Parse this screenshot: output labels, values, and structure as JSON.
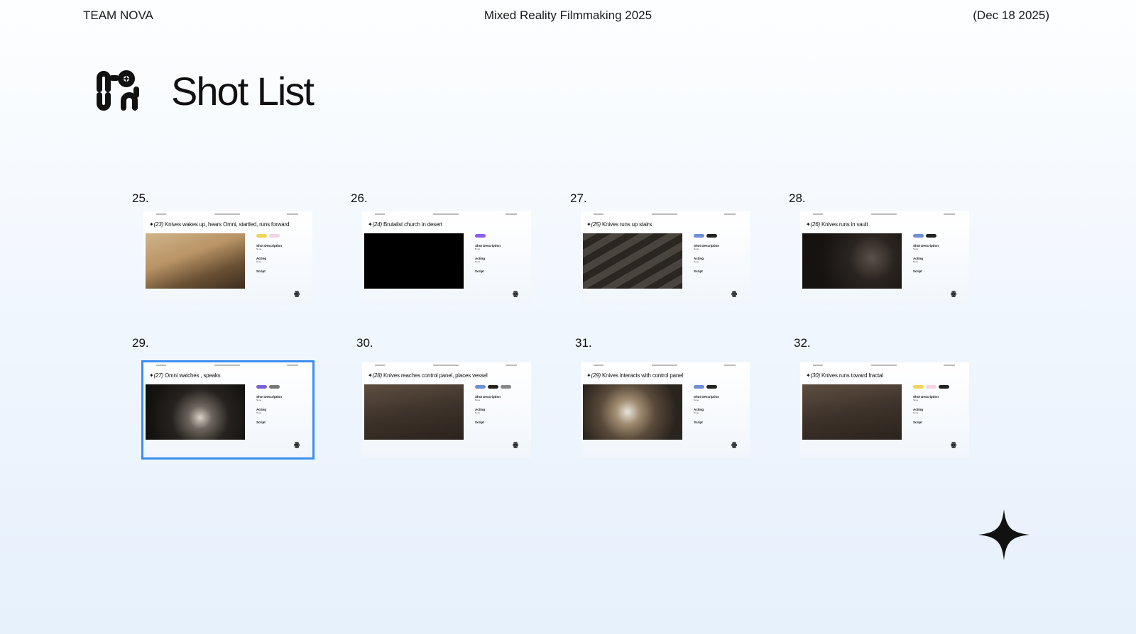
{
  "header": {
    "team": "TEAM NOVA",
    "project": "Mixed Reality Filmmaking 2025",
    "date": "(Dec 18 2025)"
  },
  "page_title": "Shot List",
  "colors": {
    "selection": "#3b8ff0",
    "accent": "#111111"
  },
  "section_labels": {
    "description": "Shot Description",
    "acting": "Acting",
    "script": "Script",
    "none": "None"
  },
  "slides": [
    {
      "number": "25.",
      "shot": "(23)",
      "title": "Knives wakes up, hears Omni, startled, runs forward",
      "badges": [
        "#f2d35a",
        "#f3d4e4"
      ],
      "image": "desert",
      "selected": false
    },
    {
      "number": "26.",
      "shot": "(24)",
      "title": "Brutalist church in desert",
      "badges": [
        "#8a5cf0"
      ],
      "image": "black",
      "selected": false
    },
    {
      "number": "27.",
      "shot": "(25)",
      "title": "Knives runs up stairs",
      "badges": [
        "#6d8fd6",
        "#222222"
      ],
      "image": "stairs",
      "selected": false
    },
    {
      "number": "28.",
      "shot": "(26)",
      "title": "Knives runs in vault",
      "badges": [
        "#6d8fd6",
        "#222222"
      ],
      "image": "vault",
      "selected": false
    },
    {
      "number": "29.",
      "shot": "(27)",
      "title": "Omni watches , speaks",
      "badges": [
        "#7a62d6",
        "#777777"
      ],
      "image": "omni",
      "selected": true
    },
    {
      "number": "30.",
      "shot": "(28)",
      "title": "Knives reaches control panel, places vessel",
      "badges": [
        "#6d8fd6",
        "#222222",
        "#888888"
      ],
      "image": "panel",
      "selected": false
    },
    {
      "number": "31.",
      "shot": "(29)",
      "title": "Knives interacts with control panel",
      "badges": [
        "#6d8fd6",
        "#222222"
      ],
      "image": "fractal",
      "selected": false
    },
    {
      "number": "32.",
      "shot": "(30)",
      "title": "Knives runs toward fractal",
      "badges": [
        "#f2d35a",
        "#f3d4e4",
        "#222222"
      ],
      "image": "panel",
      "selected": false
    }
  ]
}
